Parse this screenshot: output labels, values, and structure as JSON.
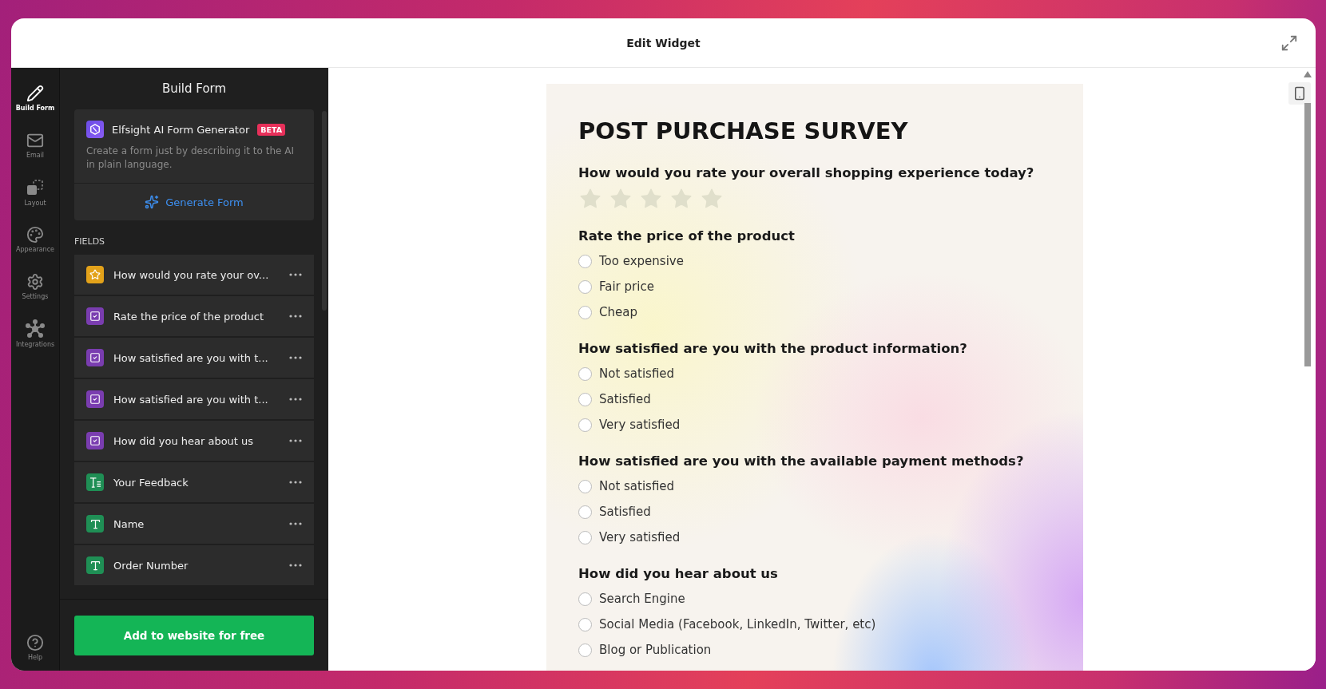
{
  "window": {
    "title": "Edit Widget"
  },
  "rail": {
    "items": [
      {
        "kind": "pen",
        "label": "Build Form",
        "selected": true
      },
      {
        "kind": "mail",
        "label": "Email",
        "selected": false
      },
      {
        "kind": "layout",
        "label": "Layout",
        "selected": false
      },
      {
        "kind": "palette",
        "label": "Appearance",
        "selected": false
      },
      {
        "kind": "gear",
        "label": "Settings",
        "selected": false
      },
      {
        "kind": "hub",
        "label": "Integrations",
        "selected": false
      }
    ],
    "help": {
      "label": "Help"
    }
  },
  "panel": {
    "title": "Build Form",
    "ai_card": {
      "title": "Elfsight AI Form Generator",
      "badge": "BETA",
      "description": "Create a form just by describing it to the AI in plain language.",
      "action": "Generate Form"
    },
    "fields_label": "FIELDS",
    "fields": [
      {
        "kind": "rating",
        "label": "How would you rate your ov..."
      },
      {
        "kind": "choice",
        "label": "Rate the price of the product"
      },
      {
        "kind": "choice",
        "label": "How satisfied are you with t..."
      },
      {
        "kind": "choice",
        "label": "How satisfied are you with t..."
      },
      {
        "kind": "choice",
        "label": "How did you hear about us"
      },
      {
        "kind": "textarea",
        "label": "Your Feedback"
      },
      {
        "kind": "text",
        "label": "Name"
      },
      {
        "kind": "text",
        "label": "Order Number"
      }
    ],
    "cta": "Add to website for free"
  },
  "form": {
    "title": "POST PURCHASE SURVEY",
    "questions": [
      {
        "kind": "rating",
        "label": "How would you rate your overall shopping experience today?",
        "stars": 0
      },
      {
        "kind": "choice",
        "label": "Rate the price of the product",
        "options": [
          {
            "label": "Too expensive",
            "selected": false
          },
          {
            "label": "Fair price",
            "selected": false
          },
          {
            "label": "Cheap",
            "selected": false
          }
        ]
      },
      {
        "kind": "choice",
        "label": "How satisfied are you with the product information?",
        "options": [
          {
            "label": "Not satisfied",
            "selected": false
          },
          {
            "label": "Satisfied",
            "selected": false
          },
          {
            "label": "Very satisfied",
            "selected": false
          }
        ]
      },
      {
        "kind": "choice",
        "label": "How satisfied are you with the available payment methods?",
        "options": [
          {
            "label": "Not satisfied",
            "selected": false
          },
          {
            "label": "Satisfied",
            "selected": false
          },
          {
            "label": "Very satisfied",
            "selected": false
          }
        ]
      },
      {
        "kind": "choice",
        "label": "How did you hear about us",
        "options": [
          {
            "label": "Search Engine",
            "selected": false
          },
          {
            "label": "Social Media (Facebook, LinkedIn, Twitter, etc)",
            "selected": false
          },
          {
            "label": "Blog or Publication",
            "selected": false
          }
        ]
      }
    ]
  }
}
